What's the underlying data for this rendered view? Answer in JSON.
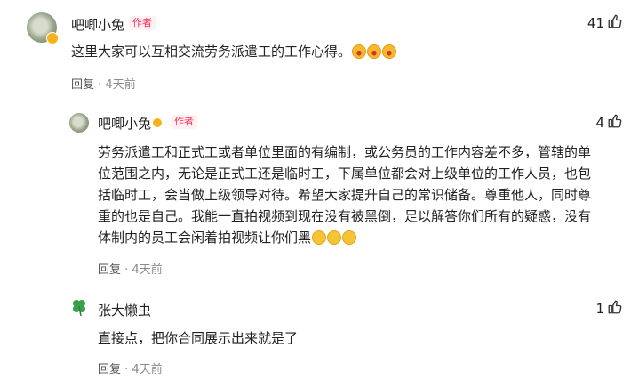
{
  "comments": [
    {
      "name": "吧唧小兔",
      "author_tag": "作者",
      "text": "这里大家可以互相交流劳务派遣工的工作心得。",
      "likes": "41",
      "reply_label": "回复",
      "time": "4天前"
    },
    {
      "name": "吧唧小兔",
      "author_tag": "作者",
      "text_lines": [
        "劳务派遣工和正式工或者单位里面的有编制，或公务员的工作内容差不多，管辖的单",
        "位范围之内，无论是正式工还是临时工，下属单位都会对上级单位的工作人员，也包",
        "括临时工，会当做上级领导对待。希望大家提升自己的常识储备。尊重他人，同时尊",
        "重的也是自己。我能一直拍视频到现在没有被黑倒，足以解答你们所有的疑惑，没有",
        "体制内的员工会闲着拍视频让你们黑"
      ],
      "likes": "4",
      "reply_label": "回复",
      "time": "4天前"
    },
    {
      "name": "张大懒虫",
      "text": "直接点，把你合同展示出来就是了",
      "likes": "1",
      "reply_label": "回复",
      "time": "4天前"
    }
  ],
  "icons": {
    "like": "thumb-up-icon",
    "verified": "verified-badge-icon",
    "emoji_laugh": "laugh-emoji-icon",
    "emoji_smile": "smile-emoji-icon"
  },
  "colors": {
    "author_tag": "#fe2c55",
    "meta": "#8a8a8a"
  }
}
